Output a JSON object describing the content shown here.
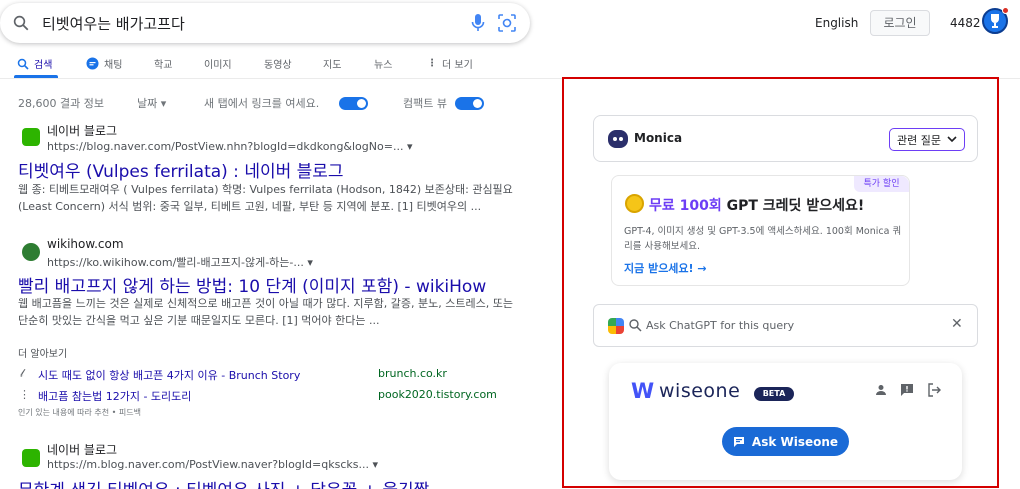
{
  "search": {
    "query": "티벳여우는 배가고프다"
  },
  "header": {
    "language": "English",
    "login": "로그인",
    "points": "4482"
  },
  "tabs": [
    {
      "label": "검색"
    },
    {
      "label": "채팅"
    },
    {
      "label": "학교"
    },
    {
      "label": "이미지"
    },
    {
      "label": "동영상"
    },
    {
      "label": "지도"
    },
    {
      "label": "뉴스"
    },
    {
      "label": "더 보기"
    }
  ],
  "toolbar": {
    "count": "28,600 결과 정보",
    "period": "날짜",
    "newtab": "새 탭에서 링크를 여세요.",
    "compact": "컴팩트 뷰"
  },
  "results": [
    {
      "site": "네이버 블로그",
      "url": "https://blog.naver.com/PostView.nhn?blogId=dkdkong&logNo=...",
      "title": "티벳여우 (Vulpes ferrilata) : 네이버 블로그",
      "snippet": "웹 종: 티베트모래여우 ( Vulpes ferrilata) 학명: Vulpes ferrilata (Hodson, 1842) 보존상태: 관심필요 (Least Concern) 서식 범위: 중국 일부, 티베트 고원, 네팔, 부탄 등 지역에 분포. [1] 티벳여우의 ..."
    },
    {
      "site": "wikihow.com",
      "url": "https://ko.wikihow.com/빨리-배고프지-않게-하는-...",
      "title": "빨리 배고프지 않게 하는 방법: 10 단계 (이미지 포함) - wikiHow",
      "snippet": "웹 배고픔을 느끼는 것은 실제로 신체적으로 배고픈 것이 아닐 때가 많다. 지루함, 갈증, 분노, 스트레스, 또는 단순히 맛있는 간식을 먹고 싶은 기분 때문일지도 모른다. [1] 먹어야 한다는 ..."
    }
  ],
  "more": {
    "label": "더 알아보기",
    "items": [
      {
        "text": "시도 때도 없이 항상 배고픈 4가지 이유 - Brunch Story",
        "host": "brunch.co.kr"
      },
      {
        "text": "배고픔 참는법 12가지 - 도리도리",
        "host": "pook2020.tistory.com"
      }
    ],
    "note": "인기 있는 내용에 따라 추천 • 피드백"
  },
  "result3": {
    "site": "네이버 블로그",
    "url": "https://m.blog.naver.com/PostView.naver?blogId=qkscks...",
    "title": "무한계 생긴 티벳여우 : 티벳여우 사진 + 닮은꼴 + 울긴짤"
  },
  "panel": {
    "monica": {
      "name": "Monica",
      "related": "관련 질문"
    },
    "credit": {
      "badge": "특가 할인",
      "headline_prefix": "무료 100회",
      "headline_suffix": " GPT 크레딧 받으세요!",
      "desc": "GPT-4, 이미지 생성 및 GPT-3.5에 액세스하세요. 100회 Monica 쿼리를 사용해보세요.",
      "cta": "지금 받으세요! →"
    },
    "askgpt": {
      "placeholder": "Ask ChatGPT for this query"
    },
    "wiseone": {
      "brand": "wiseone",
      "beta": "BETA",
      "button": "Ask Wiseone"
    }
  },
  "colors": {
    "link": "#1a0dab",
    "accent": "#1a73e8",
    "monica": "#6d3ef5",
    "highlight_border": "#d40000"
  }
}
